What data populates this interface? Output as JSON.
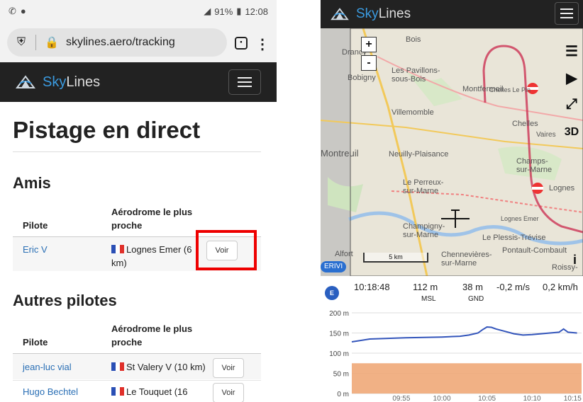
{
  "left_phone": {
    "status": {
      "left_icons": [
        "whatsapp-icon",
        "circle-icon"
      ],
      "battery": "91%",
      "time": "12:08"
    },
    "browser": {
      "url": "skylines.aero/tracking"
    },
    "brand": {
      "sky": "Sky",
      "lines": "Lines"
    },
    "page_title": "Pistage en direct",
    "friends": {
      "heading": "Amis",
      "col_pilot": "Pilote",
      "col_aerodrome": "Aérodrome le plus proche",
      "rows": [
        {
          "pilot": "Eric V",
          "aerodrome": "Lognes Emer (6 km)",
          "button": "Voir"
        }
      ]
    },
    "others": {
      "heading": "Autres pilotes",
      "col_pilot": "Pilote",
      "col_aerodrome": "Aérodrome le plus proche",
      "rows": [
        {
          "pilot": "jean-luc vial",
          "aerodrome": "St Valery V (10 km)",
          "button": "Voir"
        },
        {
          "pilot": "Hugo Bechtel",
          "aerodrome": "Le Touquet (16",
          "button": "Voir"
        }
      ]
    },
    "colors": {
      "navbar": "#222222",
      "link": "#2a6fb5",
      "highlight": "#e00000"
    }
  },
  "right_phone": {
    "brand": {
      "sky": "Sky",
      "lines": "Lines"
    },
    "map": {
      "zoom_in": "+",
      "zoom_out": "-",
      "labels": {
        "bois": "Bois",
        "drancy": "Drancy",
        "bobigny": "Bobigny",
        "pavillons": "Les Pavillons-sous-Bois",
        "montfermeil": "Montfermeil",
        "chelles_pin": "Chelles Le Pin",
        "villemomble": "Villemomble",
        "chelles": "Chelles",
        "vaires": "Vaires",
        "montreuil": "Montreuil",
        "neuilly": "Neuilly-Plaisance",
        "champs": "Champs-sur-Marne",
        "perreux": "Le Perreux-sur-Marne",
        "lognes": "Lognes",
        "champigny": "Champigny-sur-Marne",
        "lognes_emer": "Lognes Emer",
        "plessis": "Le Plessis-Trévise",
        "pontault": "Pontault-Combault",
        "chennevieres": "Chennevières-sur-Marne",
        "roissy": "Roissy-",
        "alfort": "Alfort"
      },
      "controls": {
        "three_d": "3D",
        "info": "i"
      },
      "scale": "5 km",
      "pilot_badge": "ERIVI"
    },
    "info": {
      "badge": "E",
      "time": "10:18:48",
      "altitude": "112 m",
      "altitude_ref": "MSL",
      "height": "38 m",
      "height_ref": "GND",
      "vario": "-0,2 m/s",
      "speed": "0,2 km/h"
    },
    "colors": {
      "track": "#3355bb",
      "terrain": "#f0a878",
      "route": "#cc3355"
    }
  },
  "chart_data": {
    "type": "line",
    "ylabel": "",
    "y_ticks": [
      "200 m",
      "150 m",
      "100 m",
      "50 m",
      "0 m"
    ],
    "yticks_values": [
      200,
      150,
      100,
      50,
      0
    ],
    "x_ticks": [
      "09:55",
      "10:00",
      "10:05",
      "10:10",
      "10:15"
    ],
    "ylim": [
      0,
      200
    ],
    "series": [
      {
        "points": [
          [
            9.0,
            128
          ],
          [
            9.2,
            135
          ],
          [
            9.6,
            138
          ],
          [
            10.0,
            140
          ],
          [
            10.2,
            142
          ],
          [
            10.3,
            145
          ],
          [
            10.4,
            150
          ],
          [
            10.45,
            158
          ],
          [
            10.5,
            165
          ],
          [
            10.55,
            164
          ],
          [
            10.6,
            160
          ],
          [
            10.7,
            154
          ],
          [
            10.8,
            148
          ],
          [
            10.9,
            145
          ],
          [
            11.0,
            146
          ],
          [
            11.1,
            148
          ],
          [
            11.2,
            150
          ],
          [
            11.3,
            152
          ],
          [
            11.35,
            160
          ],
          [
            11.4,
            152
          ],
          [
            11.5,
            150
          ]
        ]
      },
      {
        "points": [
          [
            9.0,
            75
          ],
          [
            11.55,
            75
          ]
        ],
        "fill": true
      }
    ]
  }
}
